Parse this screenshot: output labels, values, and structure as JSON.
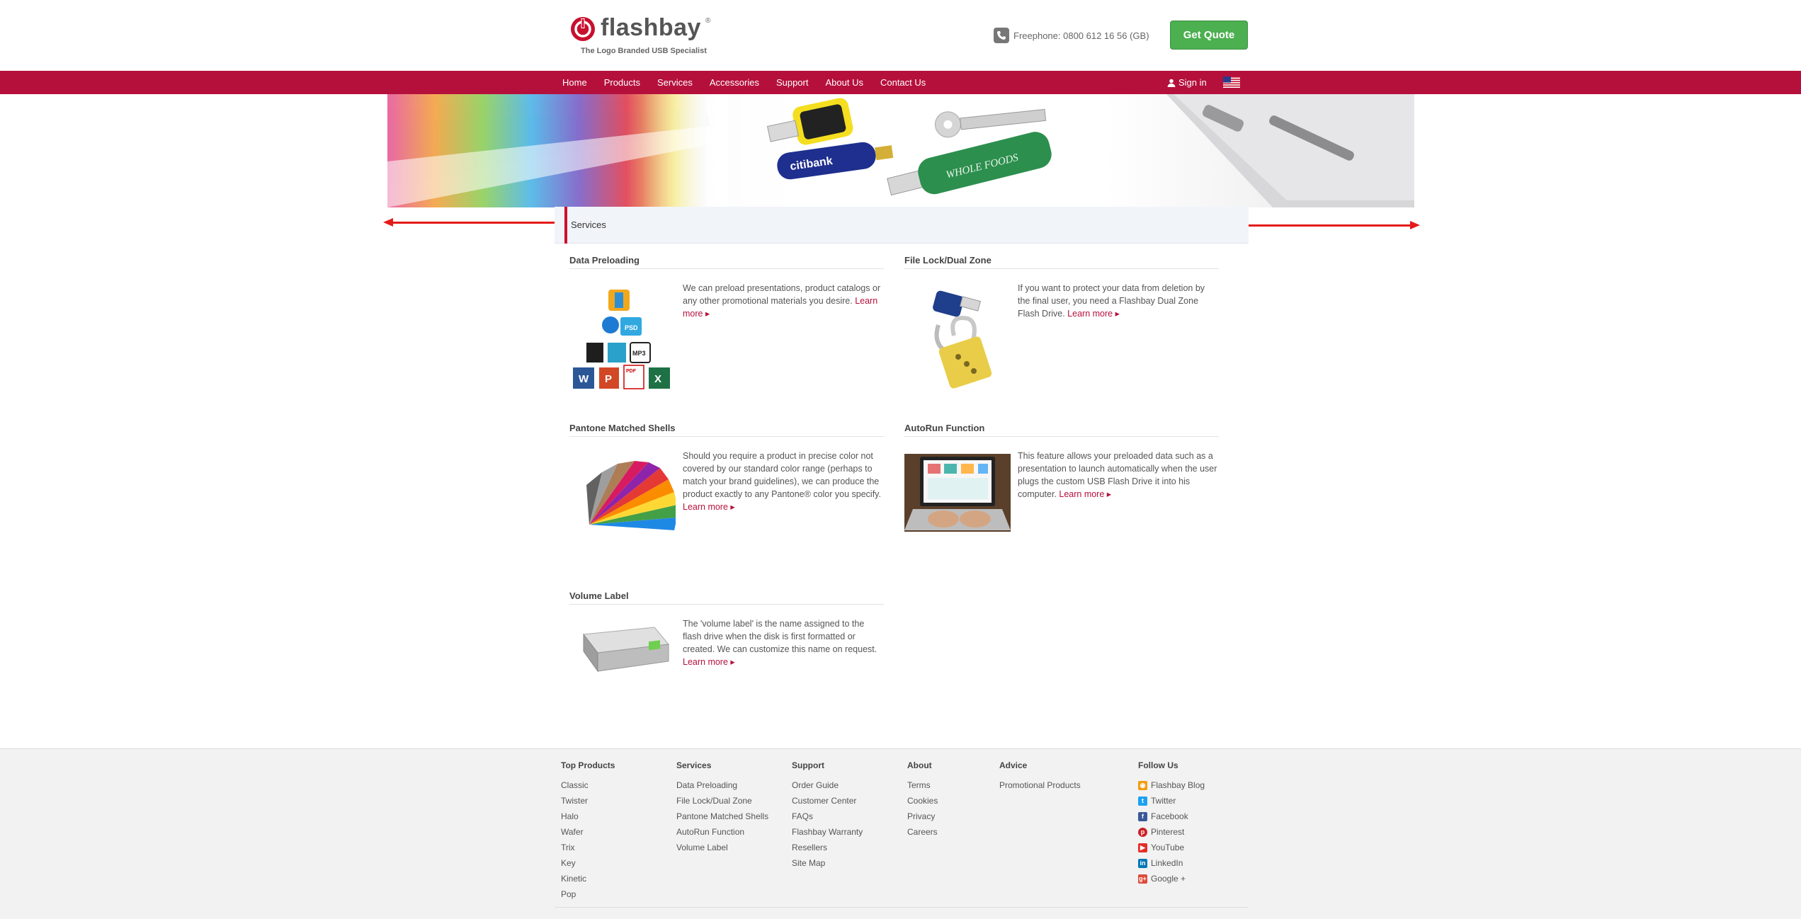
{
  "header": {
    "logo_text": "flashbay",
    "logo_reg": "®",
    "tagline": "The Logo Branded USB Specialist",
    "freephone": "Freephone: 0800 612 16 56 (GB)",
    "quote_label": "Get Quote"
  },
  "nav": {
    "items": [
      {
        "label": "Home"
      },
      {
        "label": "Products"
      },
      {
        "label": "Services"
      },
      {
        "label": "Accessories"
      },
      {
        "label": "Support"
      },
      {
        "label": "About Us"
      },
      {
        "label": "Contact Us"
      }
    ],
    "signin_label": "Sign in"
  },
  "banner": {
    "drive_label_1": "citibank",
    "drive_label_2": "WHOLE FOODS"
  },
  "section": {
    "title": "Services"
  },
  "services": [
    {
      "title": "Data Preloading",
      "text": "We can preload presentations, product catalogs or any other promotional materials you desire.",
      "learn_more": "Learn more"
    },
    {
      "title": "File Lock/Dual Zone",
      "text": "If you want to protect your data from deletion by the final user, you need a Flashbay Dual Zone Flash Drive.",
      "learn_more": "Learn more"
    },
    {
      "title": "Pantone Matched Shells",
      "text": "Should you require a product in precise color not covered by our standard color range (perhaps to match your brand guidelines), we can produce the product exactly to any Pantone® color you specify.",
      "learn_more": "Learn more"
    },
    {
      "title": "AutoRun Function",
      "text": "This feature allows your preloaded data such as a presentation to launch automatically when the user plugs the custom USB Flash Drive it into his computer.",
      "learn_more": "Learn more"
    },
    {
      "title": "Volume Label",
      "text": "The 'volume label' is the name assigned to the flash drive when the disk is first formatted or created. We can customize this name on request.",
      "learn_more": "Learn more"
    }
  ],
  "preload_icons": {
    "psd": "PSD",
    "mp3": "MP3",
    "pdf": "PDF",
    "word": "W",
    "ppt": "P",
    "excel": "X"
  },
  "footer": {
    "top_products": {
      "title": "Top Products",
      "links": [
        "Classic",
        "Twister",
        "Halo",
        "Wafer",
        "Trix",
        "Key",
        "Kinetic",
        "Pop"
      ]
    },
    "services": {
      "title": "Services",
      "links": [
        "Data Preloading",
        "File Lock/Dual Zone",
        "Pantone Matched Shells",
        "AutoRun Function",
        "Volume Label"
      ]
    },
    "support": {
      "title": "Support",
      "links": [
        "Order Guide",
        "Customer Center",
        "FAQs",
        "Flashbay Warranty",
        "Resellers",
        "Site Map"
      ]
    },
    "about": {
      "title": "About",
      "links": [
        "Terms",
        "Cookies",
        "Privacy",
        "Careers"
      ]
    },
    "advice": {
      "title": "Advice",
      "links": [
        "Promotional Products"
      ]
    },
    "follow": {
      "title": "Follow Us",
      "links": [
        {
          "label": "Flashbay Blog",
          "icon": "rss-icon",
          "color": "#f39c12"
        },
        {
          "label": "Twitter",
          "icon": "twitter-icon",
          "color": "#1da1f2"
        },
        {
          "label": "Facebook",
          "icon": "facebook-icon",
          "color": "#3b5998"
        },
        {
          "label": "Pinterest",
          "icon": "pinterest-icon",
          "color": "#cb2027"
        },
        {
          "label": "YouTube",
          "icon": "youtube-icon",
          "color": "#e52d27"
        },
        {
          "label": "LinkedIn",
          "icon": "linkedin-icon",
          "color": "#0077b5"
        },
        {
          "label": "Google +",
          "icon": "google-plus-icon",
          "color": "#dd4b39"
        }
      ]
    }
  },
  "colors": {
    "brand": "#b5103c",
    "quote": "#4caf50",
    "arrow": "#e41b1b"
  }
}
